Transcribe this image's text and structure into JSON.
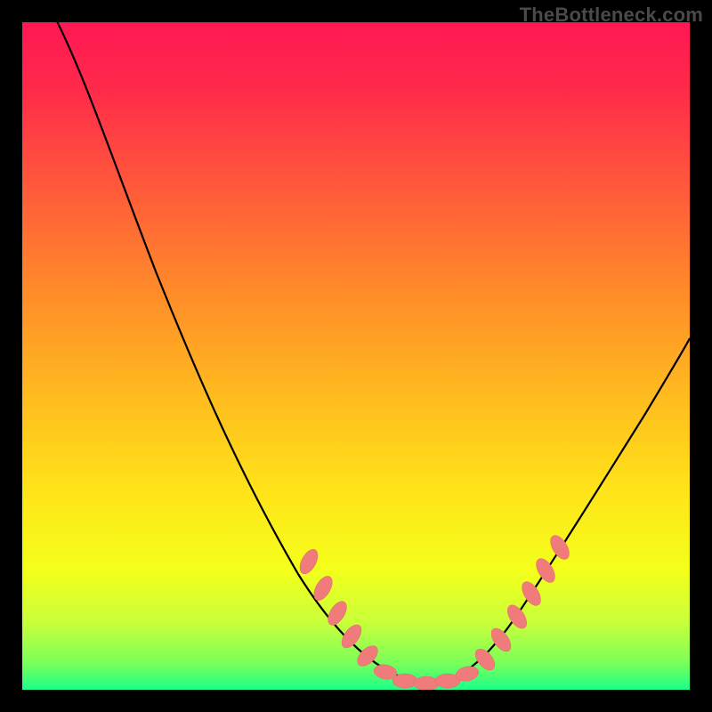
{
  "watermark": "TheBottleneck.com",
  "chart_data": {
    "type": "line",
    "title": "",
    "xlabel": "",
    "ylabel": "",
    "xlim": [
      0,
      100
    ],
    "ylim": [
      0,
      100
    ],
    "grid": false,
    "legend": false,
    "colors": {
      "gradient_top": "#ff1744",
      "gradient_mid": "#ffd600",
      "gradient_bottom": "#00e676",
      "curve": "#000000",
      "markers": "#f07070"
    },
    "series": [
      {
        "name": "curve",
        "x": [
          5,
          10,
          15,
          20,
          25,
          30,
          35,
          40,
          45,
          48,
          50,
          52,
          55,
          58,
          60,
          62,
          65,
          70,
          75,
          80,
          85,
          90,
          95,
          100
        ],
        "y": [
          100,
          96,
          90,
          82,
          73,
          63,
          52,
          40,
          28,
          20,
          14,
          9,
          5,
          2,
          1,
          1,
          2,
          6,
          13,
          22,
          32,
          43,
          52,
          60
        ],
        "note": "Estimated V-shaped bottleneck curve; minimum near x≈61, y≈1. Left arm starts off-canvas at top."
      },
      {
        "name": "markers",
        "type": "scatter",
        "marker_shape": "capsule",
        "x": [
          48,
          50,
          52,
          54,
          56,
          58,
          60,
          62,
          64,
          66,
          68,
          70,
          72,
          74,
          76
        ],
        "y": [
          20,
          14,
          9,
          6,
          4,
          2,
          1,
          1,
          2,
          3,
          5,
          6,
          9,
          12,
          16
        ],
        "note": "Salmon capsule markers cluster along the valley floor and both arms near the minimum."
      }
    ]
  }
}
